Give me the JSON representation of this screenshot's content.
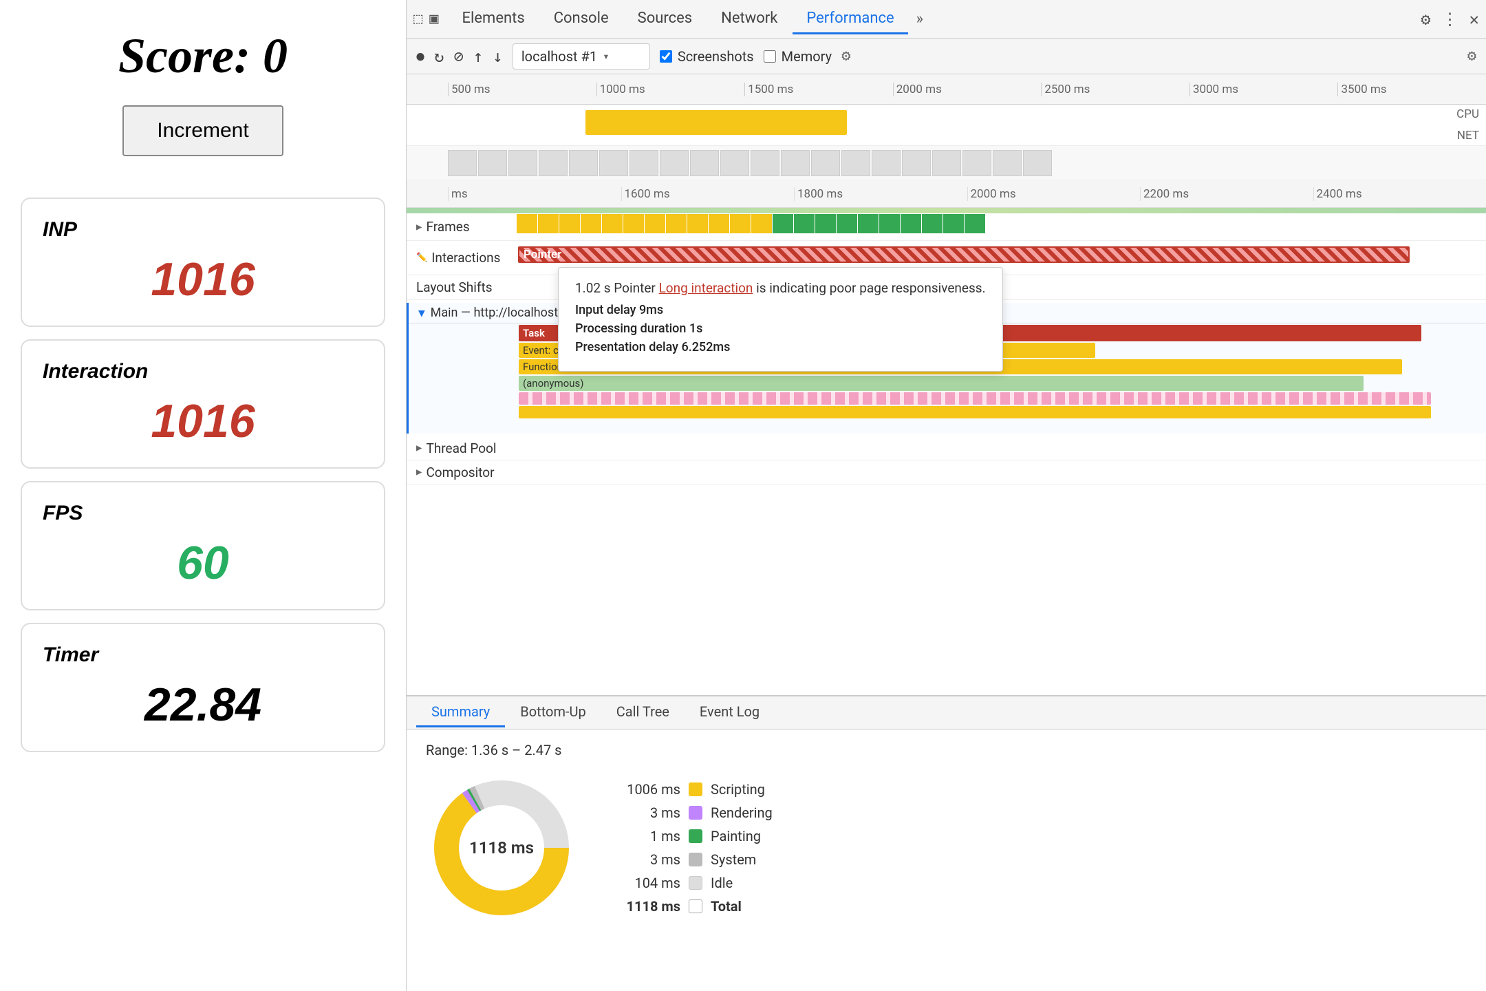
{
  "left": {
    "score_label": "Score: 0",
    "increment_btn": "Increment",
    "metrics": [
      {
        "label": "INP",
        "value": "1016",
        "color": "red"
      },
      {
        "label": "Interaction",
        "value": "1016",
        "color": "red"
      },
      {
        "label": "FPS",
        "value": "60",
        "color": "green"
      },
      {
        "label": "Timer",
        "value": "22.84",
        "color": "black"
      }
    ]
  },
  "devtools": {
    "tabs": [
      {
        "label": "Elements"
      },
      {
        "label": "Console"
      },
      {
        "label": "Sources"
      },
      {
        "label": "Network"
      },
      {
        "label": "Performance",
        "active": true
      }
    ],
    "more_label": "»",
    "toolbar": {
      "url": "localhost #1",
      "screenshots_label": "Screenshots",
      "memory_label": "Memory"
    },
    "ruler": {
      "ticks": [
        "500 ms",
        "1000 ms",
        "15",
        "ms",
        "2000 ms",
        "2500 m",
        "3000 ms",
        "3500 m"
      ]
    },
    "ruler2": {
      "ticks": [
        "ms",
        "1600 ms",
        "1800 ms",
        "2000 ms",
        "2200 ms",
        "2400 ms"
      ]
    },
    "tracks": {
      "frames_label": "Frames",
      "interactions_label": "Interactions",
      "pointer_label": "Pointer",
      "layout_shifts_label": "Layout Shifts",
      "main_label": "Main — http://localhost:51",
      "task_label": "Task",
      "event_click_label": "Event: click",
      "function_call_label": "Function Call",
      "anonymous_label": "(anonymous)",
      "thread_pool_label": "Thread Pool",
      "compositor_label": "Compositor"
    },
    "tooltip": {
      "timing": "1.02 s",
      "type": "Pointer",
      "link_text": "Long interaction",
      "message": "is indicating poor page responsiveness.",
      "input_delay_label": "Input delay",
      "input_delay_value": "9ms",
      "processing_label": "Processing duration",
      "processing_value": "1s",
      "presentation_label": "Presentation delay",
      "presentation_value": "6.252ms"
    },
    "bottom": {
      "tabs": [
        {
          "label": "Summary",
          "active": true
        },
        {
          "label": "Bottom-Up"
        },
        {
          "label": "Call Tree"
        },
        {
          "label": "Event Log"
        }
      ],
      "range_label": "Range: 1.36 s – 2.47 s",
      "donut_label": "1118 ms",
      "legend": [
        {
          "ms": "1006 ms",
          "color": "#f5c518",
          "name": "Scripting"
        },
        {
          "ms": "3 ms",
          "color": "#c084fc",
          "name": "Rendering"
        },
        {
          "ms": "1 ms",
          "color": "#34a853",
          "name": "Painting"
        },
        {
          "ms": "3 ms",
          "color": "#bbb",
          "name": "System"
        },
        {
          "ms": "104 ms",
          "color": "#ddd",
          "name": "Idle"
        },
        {
          "ms": "1118 ms",
          "color": "#fff",
          "name": "Total",
          "border": true
        }
      ]
    }
  }
}
